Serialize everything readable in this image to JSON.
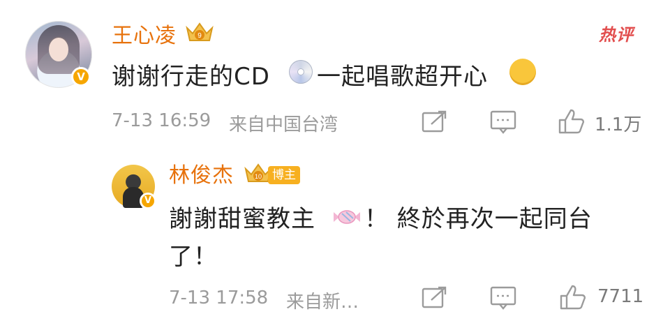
{
  "comment": {
    "author": "王心凌",
    "text_part1": "谢谢行走的CD",
    "cd_emoji": "cd-emoji",
    "text_part2": "一起唱歌超开心",
    "party_emoji": "party-face-emoji",
    "time": "7-13 16:59",
    "location": "来自中国台湾",
    "likes": "1.1万",
    "hot_tag": "热评",
    "crown_level": "9"
  },
  "reply": {
    "author": "林俊杰",
    "badge": "博主",
    "crown_level": "10",
    "text_line1_part1": "謝謝甜蜜教主",
    "candy_emoji": "candy-emoji",
    "text_line1_part2": "！ 終於再次一起同台",
    "text_line2": "了！",
    "time": "7-13 17:58",
    "location": "来自新…",
    "likes": "7711"
  },
  "colors": {
    "name": "#e7720c",
    "meta": "#9b9b9b",
    "text": "#222222",
    "hot": "#e24e4e",
    "badge": "#f7b020",
    "verified": "#f6a600"
  },
  "icons": [
    "share-icon",
    "comment-icon",
    "like-icon"
  ]
}
